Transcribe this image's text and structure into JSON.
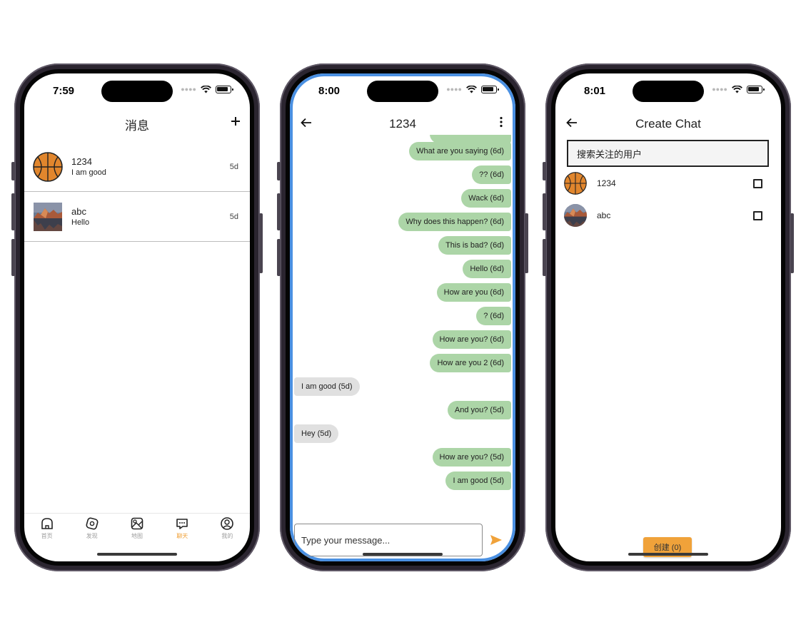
{
  "phone1": {
    "status_time": "7:59",
    "title": "消息",
    "conversations": [
      {
        "name": "1234",
        "last_message": "I am good",
        "time": "5d",
        "avatar": "basketball"
      },
      {
        "name": "abc",
        "last_message": "Hello",
        "time": "5d",
        "avatar": "landscape-photo"
      }
    ],
    "tabs": [
      {
        "label": "首页",
        "icon": "home-icon",
        "active": false
      },
      {
        "label": "发现",
        "icon": "compass-icon",
        "active": false
      },
      {
        "label": "地图",
        "icon": "map-image-icon",
        "active": false
      },
      {
        "label": "聊天",
        "icon": "chat-icon",
        "active": true
      },
      {
        "label": "我的",
        "icon": "profile-icon",
        "active": false
      }
    ]
  },
  "phone2": {
    "status_time": "8:00",
    "title": "1234",
    "messages": [
      {
        "text": "What are you saying (6d)",
        "from": "me"
      },
      {
        "text": "?? (6d)",
        "from": "me"
      },
      {
        "text": "Wack (6d)",
        "from": "me"
      },
      {
        "text": "Why does this happen? (6d)",
        "from": "me"
      },
      {
        "text": "This is bad? (6d)",
        "from": "me"
      },
      {
        "text": "Hello (6d)",
        "from": "me"
      },
      {
        "text": "How are you (6d)",
        "from": "me"
      },
      {
        "text": "? (6d)",
        "from": "me"
      },
      {
        "text": "How are you? (6d)",
        "from": "me"
      },
      {
        "text": "How are you 2 (6d)",
        "from": "me"
      },
      {
        "text": "I am good (5d)",
        "from": "other"
      },
      {
        "text": "And you? (5d)",
        "from": "me"
      },
      {
        "text": "Hey (5d)",
        "from": "other"
      },
      {
        "text": "How are you? (5d)",
        "from": "me"
      },
      {
        "text": "I am good (5d)",
        "from": "me"
      }
    ],
    "input_placeholder": "Type your message..."
  },
  "phone3": {
    "status_time": "8:01",
    "title": "Create Chat",
    "search_placeholder": "搜索关注的用户",
    "users": [
      {
        "name": "1234",
        "avatar": "basketball",
        "checked": false
      },
      {
        "name": "abc",
        "avatar": "landscape-photo",
        "checked": false
      }
    ],
    "create_button": "创建 (0)"
  },
  "colors": {
    "accent": "#f0a23a",
    "sent_bubble": "#acd5a7",
    "received_bubble": "#e0e0e0",
    "focus_border": "#4a90e2"
  }
}
